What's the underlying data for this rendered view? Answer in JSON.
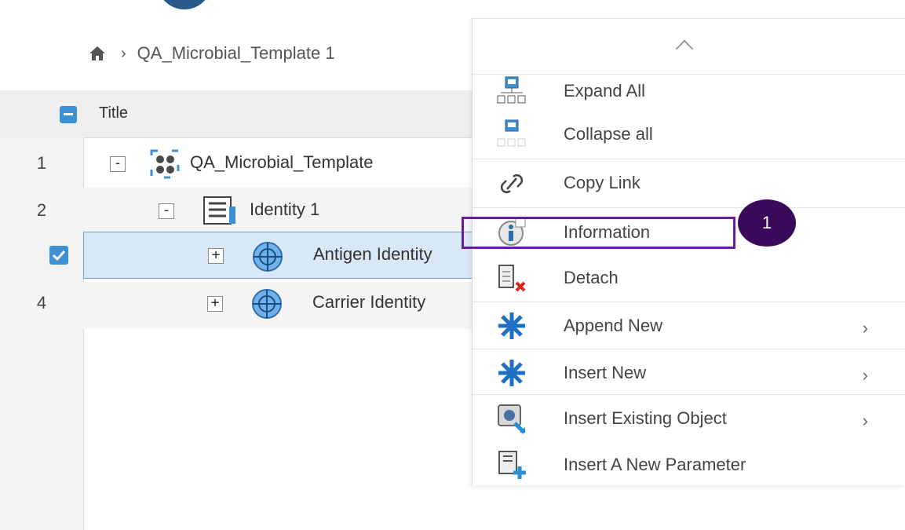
{
  "breadcrumb": {
    "home_icon": "home-icon",
    "separator": "›",
    "item": "QA_Microbial_Template 1"
  },
  "table": {
    "header_title": "Title",
    "rows": [
      {
        "num": "1",
        "toggle": "-",
        "icon": "structure-icon",
        "label": "QA_Microbial_Template"
      },
      {
        "num": "2",
        "toggle": "-",
        "icon": "document-icon",
        "label": "Identity  1"
      },
      {
        "num": "",
        "toggle": "+",
        "icon": "crosshair-icon",
        "label": "Antigen Identity"
      },
      {
        "num": "4",
        "toggle": "+",
        "icon": "crosshair-icon",
        "label": "Carrier Identity"
      }
    ]
  },
  "menu": {
    "scroll_up_icon": "chevron-up-icon",
    "items": [
      {
        "label": "Expand All",
        "icon": "expand-tree-icon"
      },
      {
        "label": "Collapse all",
        "icon": "collapse-tree-icon"
      },
      {
        "label": "Copy Link",
        "icon": "link-icon"
      },
      {
        "label": "Information",
        "icon": "info-icon"
      },
      {
        "label": "Detach",
        "icon": "detach-icon"
      },
      {
        "label": "Append New",
        "icon": "asterisk-icon",
        "submenu": "›"
      },
      {
        "label": "Insert New",
        "icon": "asterisk-icon",
        "submenu": "›"
      },
      {
        "label": "Insert Existing Object",
        "icon": "insert-object-icon",
        "submenu": "›"
      },
      {
        "label": "Insert A New Parameter",
        "icon": "insert-parameter-icon"
      }
    ]
  },
  "callout": {
    "number": "1"
  },
  "colors": {
    "highlight": "#6a1b9a",
    "callout": "#3a0a5a",
    "selection": "#d9e8f6",
    "accent": "#3d8fd6"
  }
}
